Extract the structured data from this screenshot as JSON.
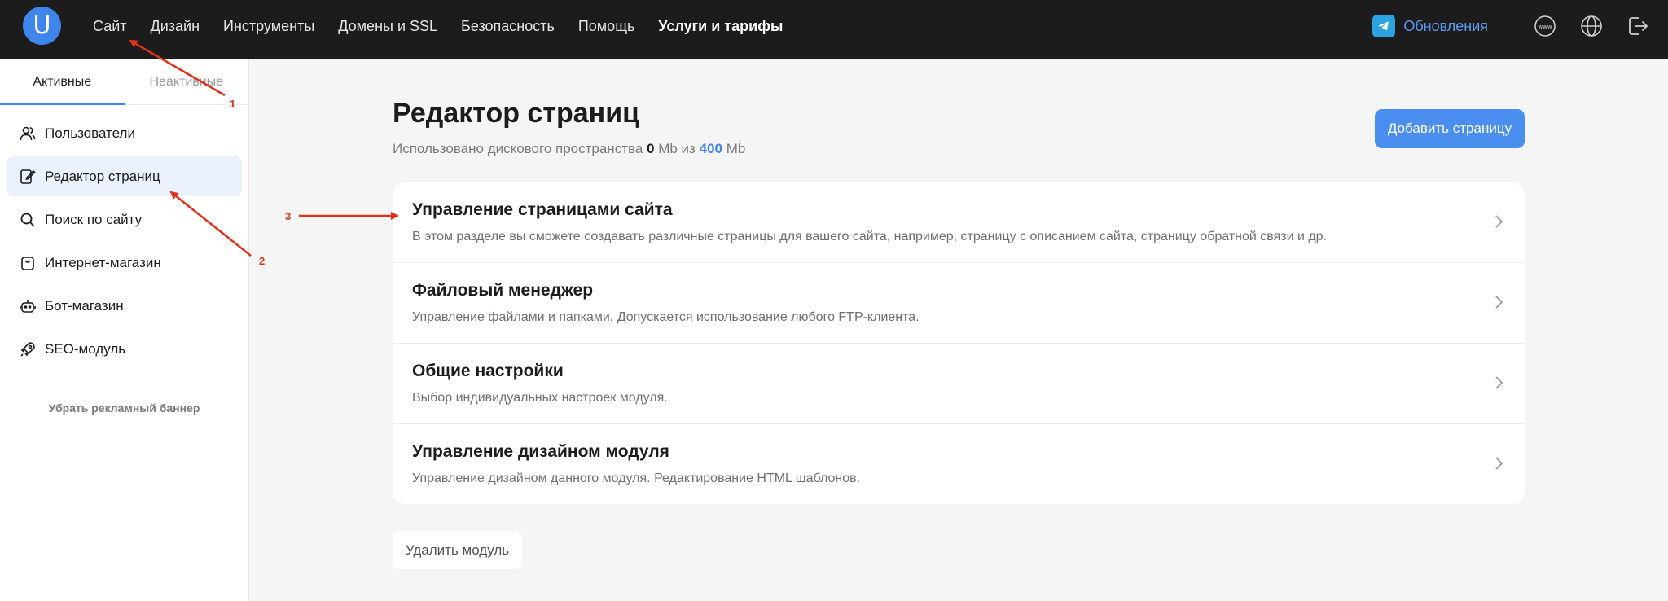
{
  "header": {
    "logo_letter": "U",
    "nav": [
      "Сайт",
      "Дизайн",
      "Инструменты",
      "Домены и SSL",
      "Безопасность",
      "Помощь",
      "Услуги и тарифы"
    ],
    "updates_label": "Обновления",
    "icons": [
      "telegram-icon",
      "www-icon",
      "globe-icon",
      "logout-icon"
    ]
  },
  "sidebar": {
    "tabs": [
      "Активные",
      "Неактивные"
    ],
    "items": [
      {
        "label": "Пользователи",
        "icon": "users-icon"
      },
      {
        "label": "Редактор страниц",
        "icon": "page-editor-icon"
      },
      {
        "label": "Поиск по сайту",
        "icon": "search-icon"
      },
      {
        "label": "Интернет-магазин",
        "icon": "shopping-bag-icon"
      },
      {
        "label": "Бот-магазин",
        "icon": "bot-icon"
      },
      {
        "label": "SEO-модуль",
        "icon": "rocket-icon"
      }
    ],
    "banner_link": "Убрать рекламный баннер"
  },
  "main": {
    "title": "Редактор страниц",
    "disk_prefix": "Использовано дискового пространства",
    "disk_used": "0",
    "disk_unit1": "Mb из",
    "disk_total": "400",
    "disk_unit2": "Mb",
    "add_button": "Добавить страницу",
    "cards": [
      {
        "title": "Управление страницами сайта",
        "desc": "В этом разделе вы сможете создавать различные страницы для вашего сайта, например, страницу с описанием сайта, страницу обратной связи и др."
      },
      {
        "title": "Файловый менеджер",
        "desc": "Управление файлами и папками. Допускается использование любого FTP-клиента."
      },
      {
        "title": "Общие настройки",
        "desc": "Выбор индивидуальных настроек модуля."
      },
      {
        "title": "Управление дизайном модуля",
        "desc": "Управление дизайном данного модуля. Редактирование HTML шаблонов."
      }
    ],
    "delete_button": "Удалить модуль"
  },
  "annotations": [
    "1",
    "2",
    "3"
  ],
  "colors": {
    "accent": "#3f86ec",
    "annotation": "#e0321b",
    "topbar": "#1c1c1c"
  }
}
